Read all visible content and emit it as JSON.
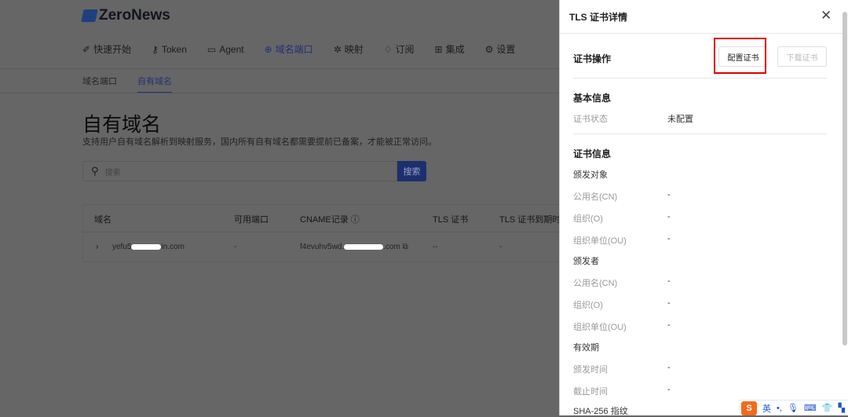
{
  "app": {
    "logo": "ZeroNews"
  },
  "nav": [
    {
      "label": "快速开始",
      "icon": "rocket-icon",
      "glyph": "✐"
    },
    {
      "label": "Token",
      "icon": "key-icon",
      "glyph": "⚷"
    },
    {
      "label": "Agent",
      "icon": "laptop-icon",
      "glyph": "▭"
    },
    {
      "label": "域名端口",
      "icon": "globe-icon",
      "glyph": "⊕",
      "active": true
    },
    {
      "label": "映射",
      "icon": "mapping-icon",
      "glyph": "✲"
    },
    {
      "label": "订阅",
      "icon": "diamond-icon",
      "glyph": "♢"
    },
    {
      "label": "集成",
      "icon": "grid-icon",
      "glyph": "⊞"
    },
    {
      "label": "设置",
      "icon": "gear-icon",
      "glyph": "⚙"
    }
  ],
  "subnav": [
    "域名端口",
    "自有域名"
  ],
  "main": {
    "title": "自有域名",
    "subtitle": "支持用户自有域名解析到映射服务，国内所有自有域名都需要提前已备案，才能被正常访问。",
    "search_placeholder": "搜索",
    "search_button": "搜索"
  },
  "table": {
    "headers": [
      "域名",
      "可用端口",
      "CNAME记录",
      "TLS 证书",
      "TLS 证书到期时间"
    ],
    "row": {
      "domain_start": "yefu5",
      "domain_end": "in.com",
      "port": "-",
      "cname_start": "f4evuhv5wd.",
      "cname_end": ".com",
      "tls": "--",
      "expiry": "-"
    }
  },
  "panel": {
    "title": "TLS 证书详情",
    "ops_label": "证书操作",
    "configure": "配置证书",
    "download": "下载证书",
    "basic": "基本信息",
    "status_label": "证书状态",
    "status_value": "未配置",
    "cert_info": "证书信息",
    "subject": "颁发对象",
    "issuer": "颁发者",
    "validity": "有效期",
    "cn": "公用名(CN)",
    "o": "组织(O)",
    "ou": "组织单位(OU)",
    "issued": "颁发时间",
    "expires": "截止时间",
    "sha": "SHA-256 指纹",
    "dash": "-"
  },
  "ime": {
    "logo": "S",
    "lang": "英"
  }
}
